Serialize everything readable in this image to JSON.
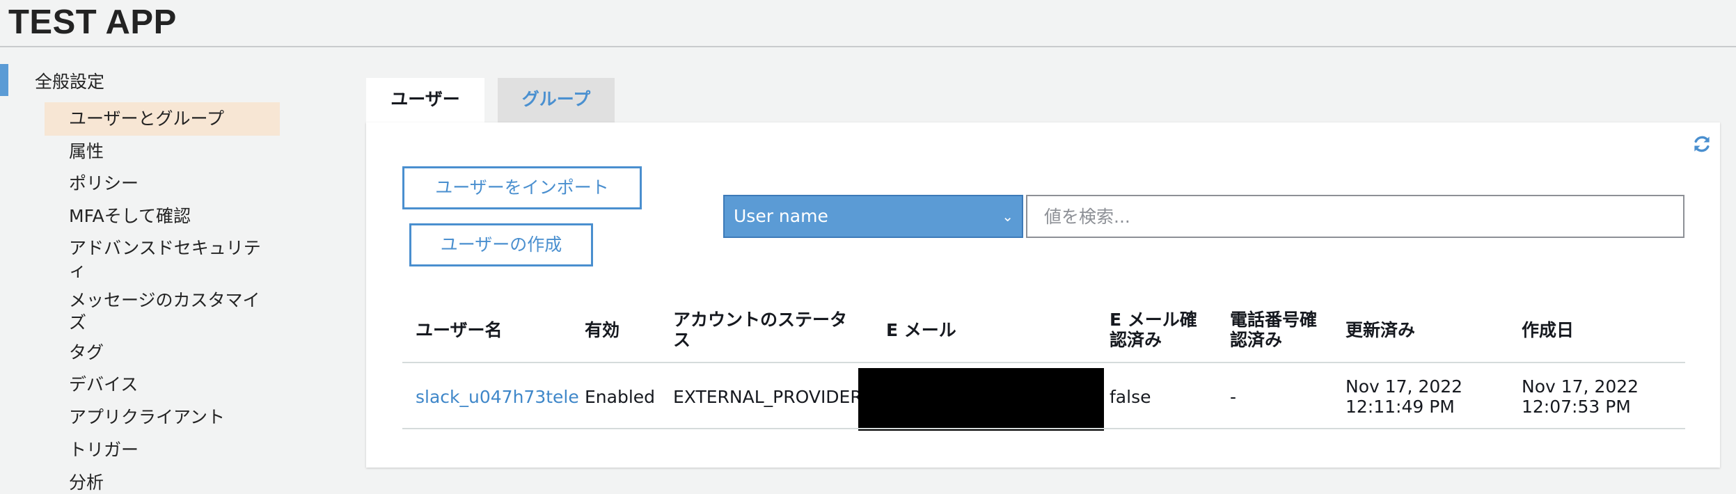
{
  "app": {
    "title": "TEST APP"
  },
  "sidebar": {
    "section": "全般設定",
    "items": [
      {
        "label": "ユーザーとグループ",
        "active": true
      },
      {
        "label": "属性"
      },
      {
        "label": "ポリシー"
      },
      {
        "label": "MFAそして確認"
      },
      {
        "label": "アドバンスドセキュリティ"
      },
      {
        "label": "メッセージのカスタマイズ"
      },
      {
        "label": "タグ"
      },
      {
        "label": "デバイス"
      },
      {
        "label": "アプリクライアント"
      },
      {
        "label": "トリガー"
      },
      {
        "label": "分析"
      }
    ]
  },
  "tabs": [
    {
      "label": "ユーザー",
      "active": true
    },
    {
      "label": "グループ",
      "active": false
    }
  ],
  "toolbar": {
    "import_label": "ユーザーをインポート",
    "create_label": "ユーザーの作成",
    "refresh_icon": "refresh-icon"
  },
  "search": {
    "attribute_selected": "User name",
    "placeholder": "値を検索..."
  },
  "table": {
    "headers": [
      "ユーザー名",
      "有効",
      "アカウントのステータス",
      "E メール",
      "E メール確認済み",
      "電話番号確認済み",
      "更新済み",
      "作成日"
    ],
    "rows": [
      {
        "username": "slack_u047h73tele",
        "enabled": "Enabled",
        "status": "EXTERNAL_PROVIDER",
        "email": "",
        "email_verified": "false",
        "phone_verified": "-",
        "updated": "Nov 17, 2022 12:11:49 PM",
        "created": "Nov 17, 2022 12:07:53 PM"
      }
    ]
  },
  "colors": {
    "accent": "#5b9bd5",
    "link": "#3f87c9",
    "active_highlight": "#f7e6d4",
    "background": "#f2f3f3"
  }
}
